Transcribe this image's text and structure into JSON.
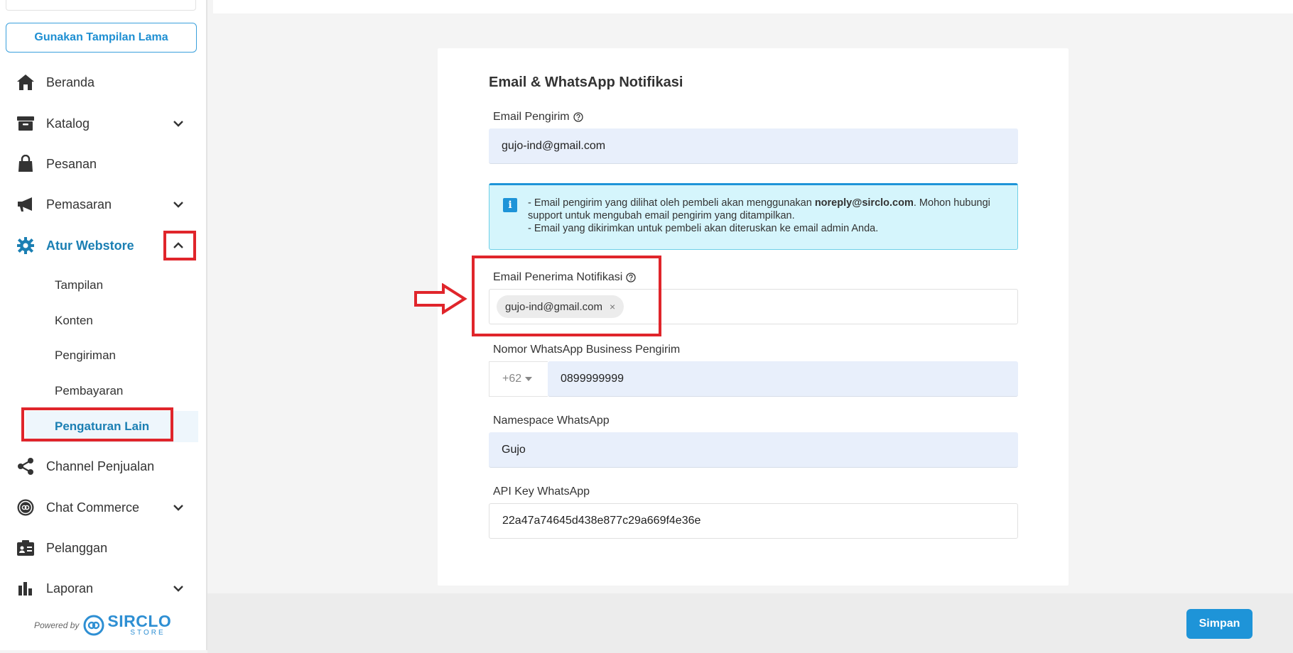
{
  "sidebar": {
    "legacy_button": "Gunakan Tampilan Lama",
    "nav": [
      {
        "label": "Beranda",
        "icon": "home-icon"
      },
      {
        "label": "Katalog",
        "icon": "archive-icon"
      },
      {
        "label": "Pesanan",
        "icon": "shopping-bag-icon"
      },
      {
        "label": "Pemasaran",
        "icon": "megaphone-icon"
      },
      {
        "label": "Atur Webstore",
        "icon": "gear-icon"
      },
      {
        "label": "Channel Penjualan",
        "icon": "share-icon"
      },
      {
        "label": "Chat Commerce",
        "icon": "chat-commerce-icon"
      },
      {
        "label": "Pelanggan",
        "icon": "customer-card-icon"
      },
      {
        "label": "Laporan",
        "icon": "report-chart-icon"
      }
    ],
    "subnav": [
      "Tampilan",
      "Konten",
      "Pengiriman",
      "Pembayaran",
      "Pengaturan Lain"
    ],
    "powered_by": "Powered by",
    "brand_name": "SIRCLO",
    "brand_sub": "STORE"
  },
  "card": {
    "title": "Email & WhatsApp Notifikasi",
    "sender_email": {
      "label": "Email Pengirim",
      "value": "gujo-ind@gmail.com"
    },
    "info": {
      "line1_pre": "- Email pengirim yang dilihat oleh pembeli akan menggunakan ",
      "line1_bold": "noreply@sirclo.com",
      "line1_post": ". Mohon hubungi support untuk mengubah email pengirim yang ditampilkan.",
      "line2": "- Email yang dikirimkan untuk pembeli akan diteruskan ke email admin Anda."
    },
    "recipient_email": {
      "label": "Email Penerima Notifikasi",
      "chip": "gujo-ind@gmail.com",
      "chip_remove": "×"
    },
    "whatsapp_number": {
      "label": "Nomor WhatsApp Business Pengirim",
      "country_code": "+62",
      "value": "0899999999"
    },
    "namespace": {
      "label": "Namespace WhatsApp",
      "value": "Gujo"
    },
    "api_key": {
      "label": "API Key WhatsApp",
      "value": "22a47a74645d438e877c29a669f4e36e"
    }
  },
  "footer": {
    "save_label": "Simpan"
  },
  "colors": {
    "accent": "#1e94d8",
    "highlight": "#e0252b",
    "info_bg": "#d5f5fc"
  }
}
